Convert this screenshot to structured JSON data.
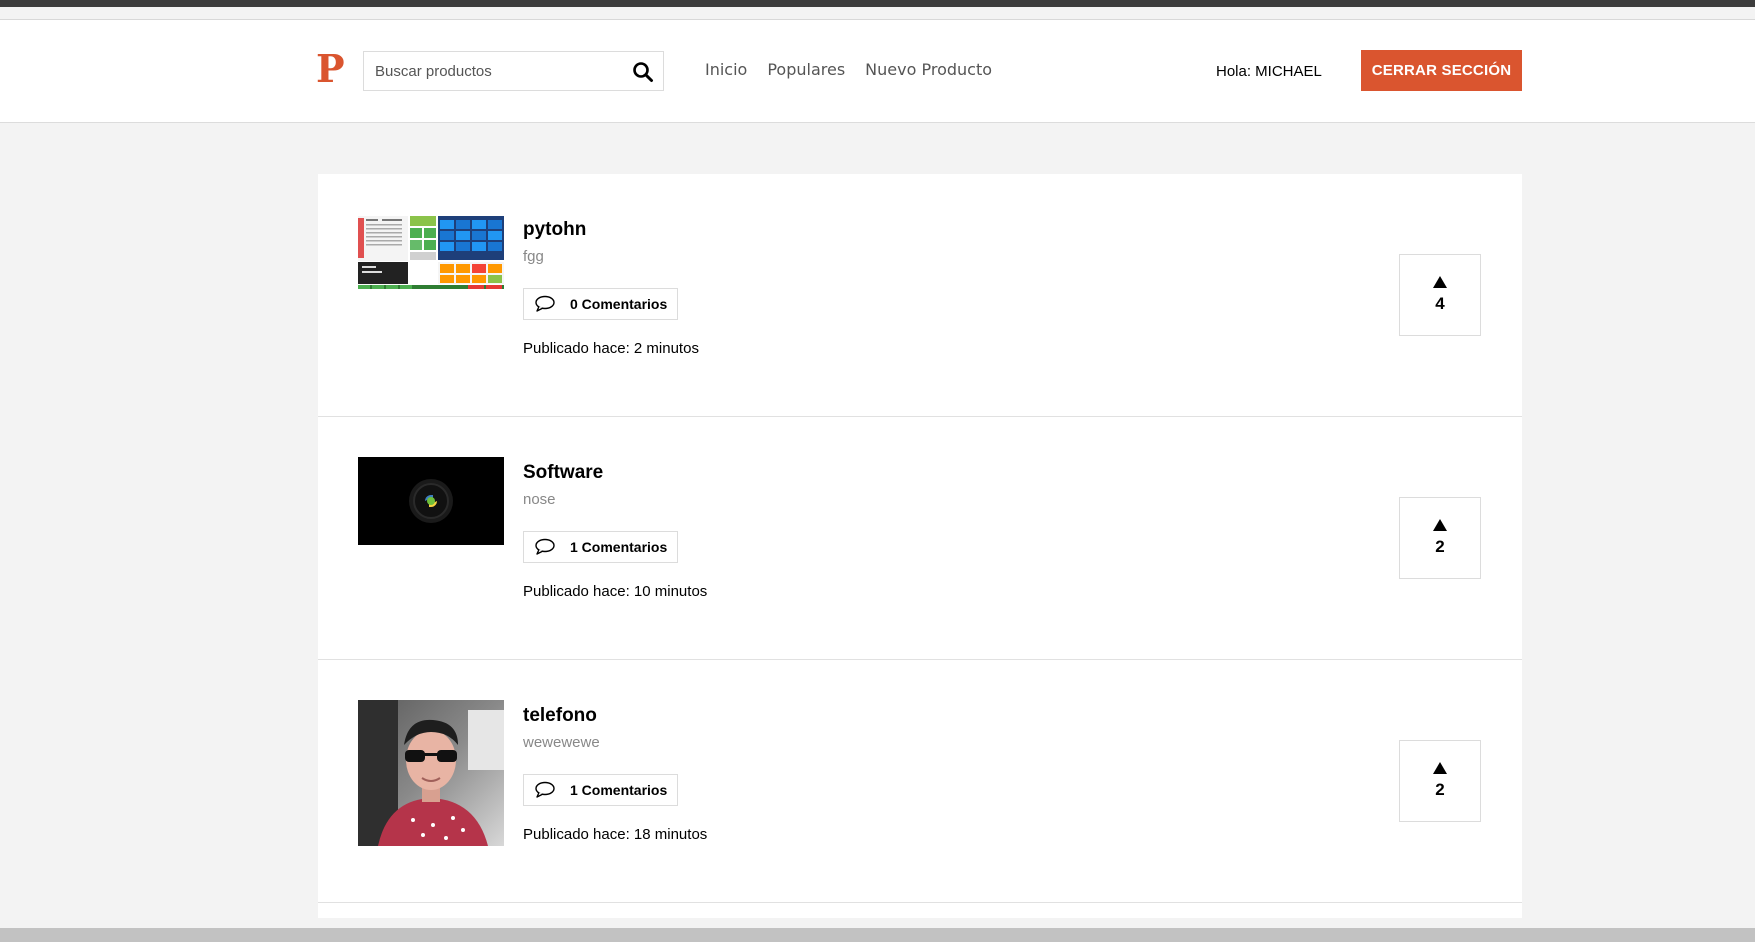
{
  "header": {
    "logo": "P",
    "search_placeholder": "Buscar productos",
    "nav": [
      "Inicio",
      "Populares",
      "Nuevo Producto"
    ],
    "greeting": "Hola: MICHAEL",
    "logout_label": "CERRAR SECCIÓN"
  },
  "products": [
    {
      "title": "pytohn",
      "description": "fgg",
      "comments": "0 Comentarios",
      "published": "Publicado hace: 2 minutos",
      "votes": "4",
      "image": "dashboard-screenshot"
    },
    {
      "title": "Software",
      "description": "nose",
      "comments": "1 Comentarios",
      "published": "Publicado hace: 10 minutos",
      "votes": "2",
      "image": "python-logo-dark"
    },
    {
      "title": "telefono",
      "description": "wewewewe",
      "comments": "1 Comentarios",
      "published": "Publicado hace: 18 minutos",
      "votes": "2",
      "image": "person-photo"
    }
  ],
  "colors": {
    "brand": "#da552f"
  }
}
